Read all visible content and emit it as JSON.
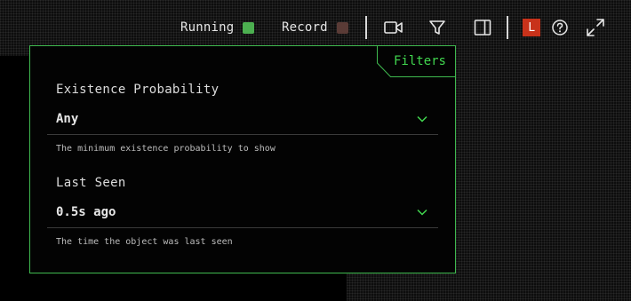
{
  "toolbar": {
    "running_label": "Running",
    "running_color": "#4caf50",
    "record_label": "Record",
    "record_color": "#5a3b36",
    "icons": [
      "video-camera-icon",
      "filter-icon",
      "sidebar-panel-icon",
      "help-icon",
      "expand-icon"
    ],
    "user_initial": "L",
    "user_color": "#c8321a"
  },
  "filters": {
    "tab_label": "Filters",
    "accent_color": "#41d64f",
    "existence": {
      "label": "Existence Probability",
      "value": "Any",
      "helper": "The minimum existence probability to show"
    },
    "last_seen": {
      "label": "Last Seen",
      "value": "0.5s ago",
      "helper": "The time the object was last seen"
    }
  }
}
